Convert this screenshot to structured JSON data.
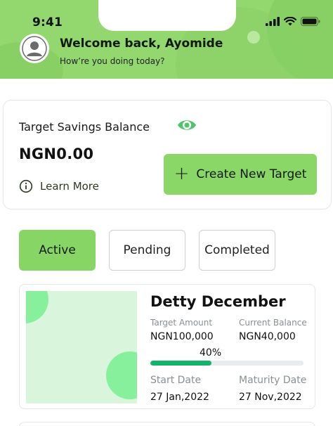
{
  "status_bar": {
    "time": "9:41"
  },
  "header": {
    "welcome": "Welcome back, Ayomide",
    "subtitle": "How’re you doing today?"
  },
  "balance": {
    "title": "Target Savings Balance",
    "amount": "NGN0.00",
    "learn_more": "Learn More",
    "create_button": "Create New Target",
    "create_plus": "+"
  },
  "tabs": [
    {
      "label": "Active",
      "selected": true
    },
    {
      "label": "Pending",
      "selected": false
    },
    {
      "label": "Completed",
      "selected": false
    }
  ],
  "targets": [
    {
      "name": "Detty December",
      "target_amount_label": "Target Amount",
      "target_amount": "NGN100,000",
      "current_balance_label": "Current Balance",
      "current_balance": "NGN40,000",
      "progress_text": "40%",
      "progress": 0.4,
      "start_date_label": "Start Date",
      "start_date": "27 Jan,2022",
      "maturity_date_label": "Maturity Date",
      "maturity_date": "27 Nov,2022"
    }
  ],
  "colors": {
    "brand_green": "#8ad667",
    "progress_green": "#14b36b",
    "thumb_bg": "#d9f6dd",
    "thumb_dots": "#86f09d"
  },
  "icons": [
    "signal-icon",
    "wifi-icon",
    "battery-icon",
    "avatar-icon",
    "eye-icon",
    "info-icon",
    "plus-icon"
  ]
}
